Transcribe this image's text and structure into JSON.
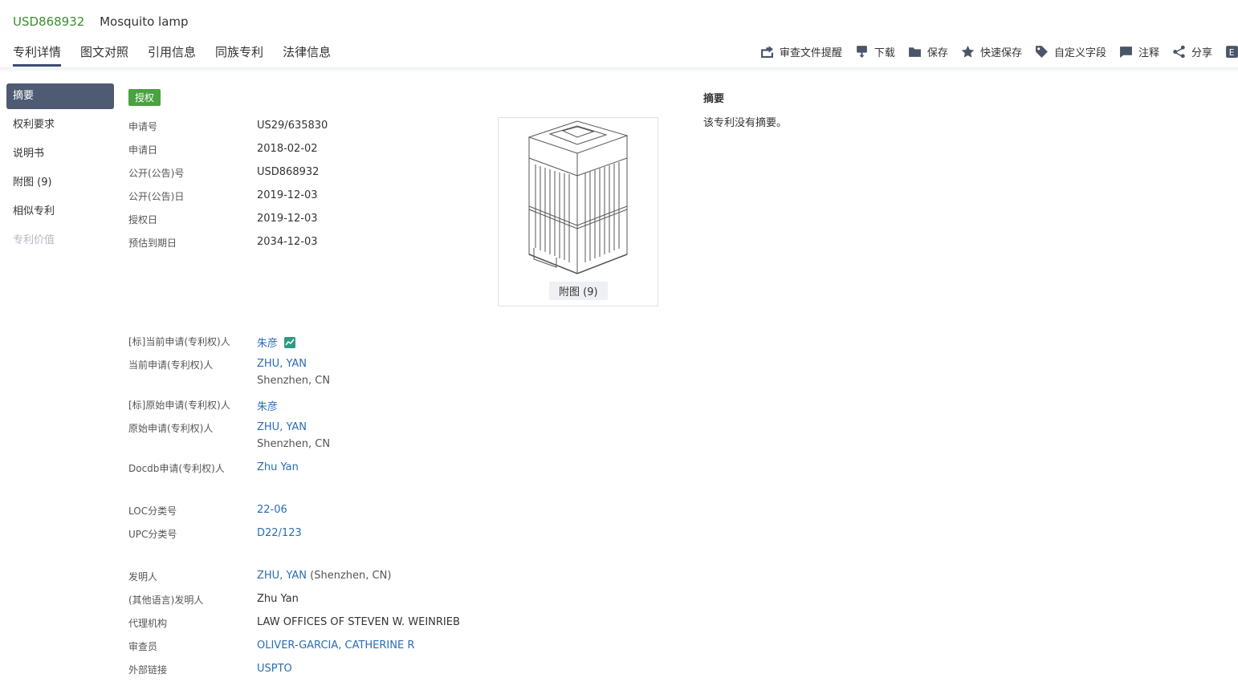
{
  "header": {
    "patent_number": "USD868932",
    "title": "Mosquito lamp"
  },
  "tabs": [
    {
      "label": "专利详情"
    },
    {
      "label": "图文对照"
    },
    {
      "label": "引用信息"
    },
    {
      "label": "同族专利"
    },
    {
      "label": "法律信息"
    }
  ],
  "toolbar": {
    "review_reminder": "审查文件提醒",
    "download": "下载",
    "save": "保存",
    "quick_save": "快速保存",
    "custom_fields": "自定义字段",
    "annotate": "注释",
    "share": "分享",
    "extra_glyph": "E"
  },
  "sidenav": [
    {
      "label": "摘要"
    },
    {
      "label": "权利要求"
    },
    {
      "label": "说明书"
    },
    {
      "label": "附图 (9)"
    },
    {
      "label": "相似专利"
    },
    {
      "label": "专利价值"
    }
  ],
  "status_badge": "授权",
  "biblio": {
    "app_no": {
      "label": "申请号",
      "value": "US29/635830"
    },
    "app_date": {
      "label": "申请日",
      "value": "2018-02-02"
    },
    "pub_no": {
      "label": "公开(公告)号",
      "value": "USD868932"
    },
    "pub_date": {
      "label": "公开(公告)日",
      "value": "2019-12-03"
    },
    "grant_date": {
      "label": "授权日",
      "value": "2019-12-03"
    },
    "expiry_date": {
      "label": "预估到期日",
      "value": "2034-12-03"
    }
  },
  "figure": {
    "label": "附图 (9)"
  },
  "applicants": {
    "std_current": {
      "label": "[标]当前申请(专利权)人",
      "value": "朱彦"
    },
    "current": {
      "label": "当前申请(专利权)人",
      "value": "ZHU, YAN",
      "location": "Shenzhen, CN"
    },
    "std_original": {
      "label": "[标]原始申请(专利权)人",
      "value": "朱彦"
    },
    "original": {
      "label": "原始申请(专利权)人",
      "value": "ZHU, YAN",
      "location": "Shenzhen, CN"
    },
    "docdb": {
      "label": "Docdb申请(专利权)人",
      "value": "Zhu Yan"
    }
  },
  "classification": {
    "loc": {
      "label": "LOC分类号",
      "value": "22-06"
    },
    "upc": {
      "label": "UPC分类号",
      "value": "D22/123"
    }
  },
  "people": {
    "inventor": {
      "label": "发明人",
      "value": "ZHU, YAN",
      "location": "(Shenzhen, CN)"
    },
    "inventor_other": {
      "label": "(其他语言)发明人",
      "value": "Zhu Yan"
    },
    "agency": {
      "label": "代理机构",
      "value": "LAW OFFICES OF STEVEN W. WEINRIEB"
    },
    "examiner": {
      "label": "审查员",
      "value": "OLIVER-GARCIA, CATHERINE R"
    },
    "external": {
      "label": "外部链接",
      "value": "USPTO"
    }
  },
  "abstract": {
    "title": "摘要",
    "text": "该专利没有摘要。"
  }
}
